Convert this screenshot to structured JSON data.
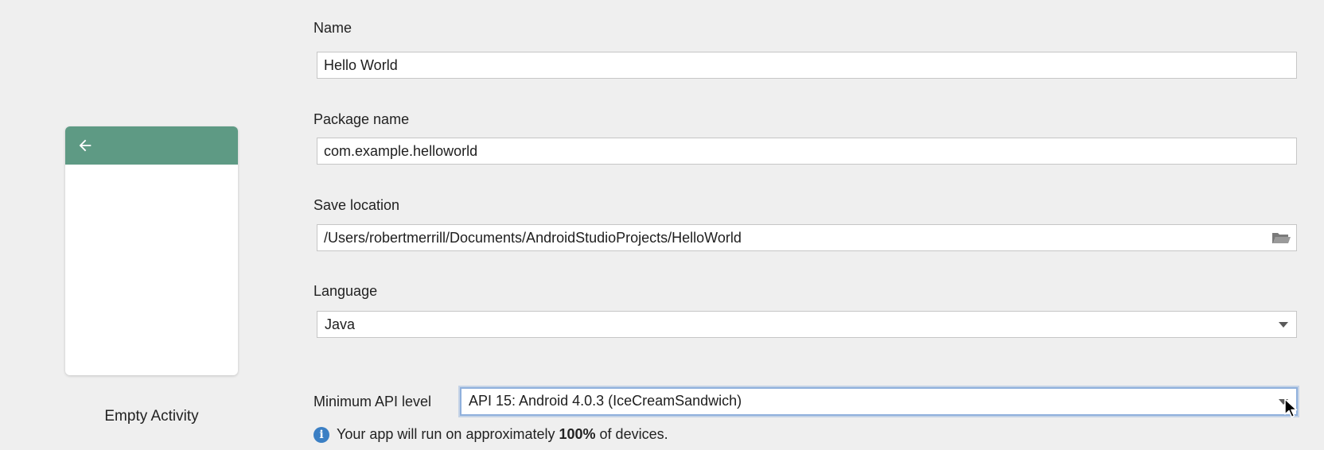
{
  "template": {
    "name": "Empty Activity"
  },
  "form": {
    "name": {
      "label": "Name",
      "value": "Hello World"
    },
    "package_name": {
      "label": "Package name",
      "value": "com.example.helloworld"
    },
    "save_location": {
      "label": "Save location",
      "value": "/Users/robertmerrill/Documents/AndroidStudioProjects/HelloWorld"
    },
    "language": {
      "label": "Language",
      "value": "Java"
    },
    "min_api": {
      "label": "Minimum API level",
      "value": "API 15: Android 4.0.3 (IceCreamSandwich)"
    },
    "info": {
      "prefix": "Your app will run on approximately ",
      "percent": "100%",
      "suffix": " of devices."
    }
  },
  "icons": {
    "back": "arrow-left-icon",
    "folder": "folder-open-icon",
    "info": "info-icon",
    "dropdown": "chevron-down-icon"
  },
  "colors": {
    "appbar": "#5e9a84",
    "info": "#3b7fc4",
    "focus": "#8fb0dc",
    "background": "#efefef"
  }
}
